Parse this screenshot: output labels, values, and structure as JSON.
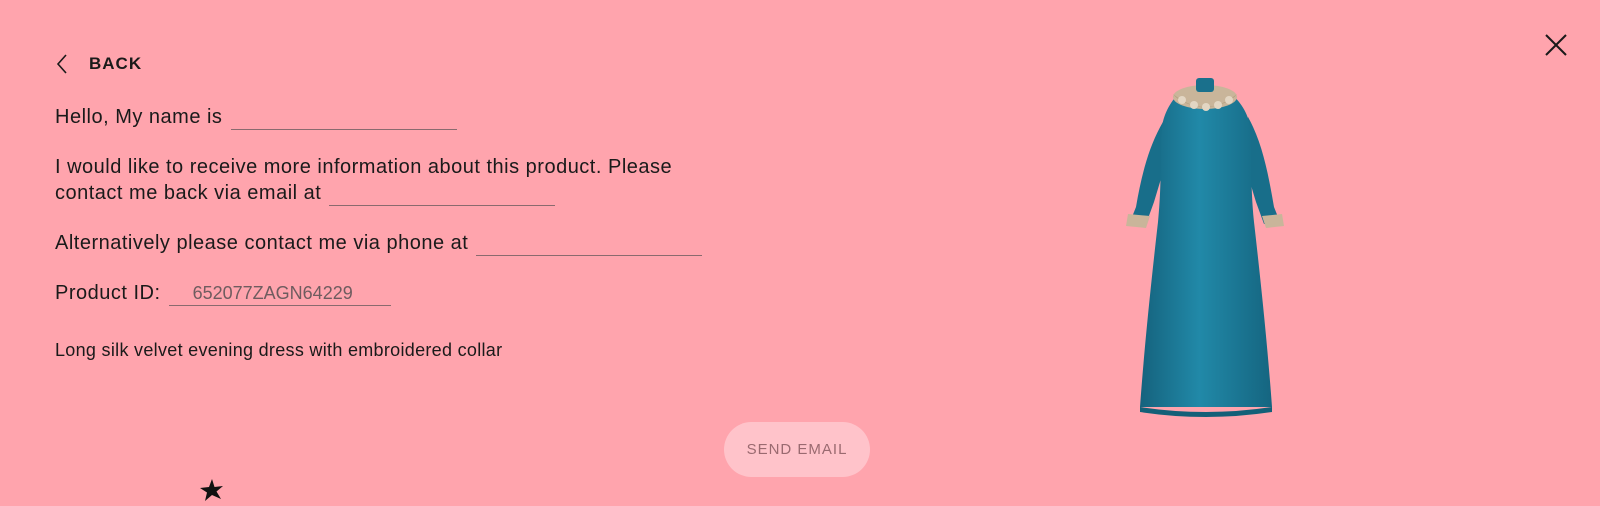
{
  "header": {
    "back_label": "BACK"
  },
  "form": {
    "name_prefix": "Hello, My name is",
    "name_value": "",
    "email_prefix_line1": "I would like to receive more information about this product. Please",
    "email_prefix_line2": "contact me back via email at",
    "email_value": "",
    "phone_prefix": "Alternatively please contact me via phone at",
    "phone_value": "",
    "product_id_label": "Product ID:",
    "product_id_value": "652077ZAGN64229"
  },
  "product": {
    "description": "Long silk velvet evening dress with embroidered collar",
    "image_name": "dress-image"
  },
  "actions": {
    "send_label": "SEND EMAIL"
  },
  "colors": {
    "background": "#ffa4ad",
    "button_bg": "#ffc3ca",
    "dress": "#1f7d9a"
  },
  "icons": [
    "close-icon",
    "chevron-left-icon",
    "cursor-star-icon"
  ]
}
